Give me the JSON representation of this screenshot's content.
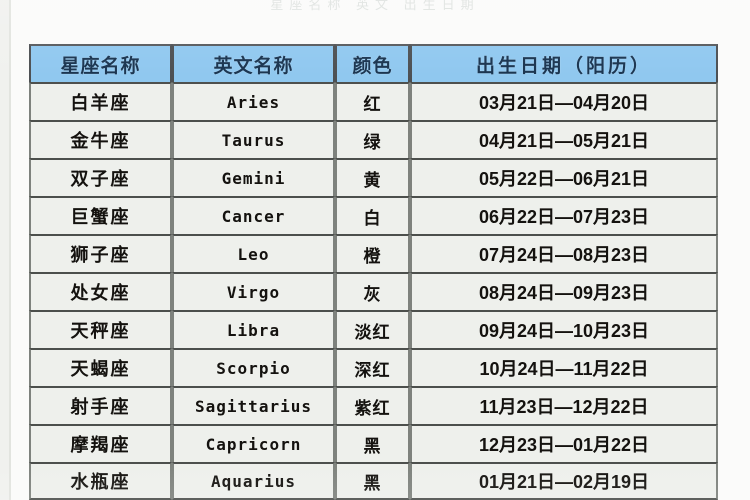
{
  "page": {
    "top_ghost_text": "星座名称   英文   出生日期",
    "background_color": "#fbfbfa"
  },
  "table": {
    "name": "zodiac-signs-table",
    "header_background": "#8ec7ef",
    "row_background": "#eef0ec",
    "border_color": "#4c4f4c",
    "columns": [
      {
        "key": "name",
        "label": "星座名称"
      },
      {
        "key": "en",
        "label": "英文名称"
      },
      {
        "key": "color",
        "label": "颜色"
      },
      {
        "key": "date",
        "label": "出生日期（阳历）"
      }
    ],
    "rows": [
      {
        "name": "白羊座",
        "en": "Aries",
        "color": "红",
        "date": "03月21日—04月20日"
      },
      {
        "name": "金牛座",
        "en": "Taurus",
        "color": "绿",
        "date": "04月21日—05月21日"
      },
      {
        "name": "双子座",
        "en": "Gemini",
        "color": "黄",
        "date": "05月22日—06月21日"
      },
      {
        "name": "巨蟹座",
        "en": "Cancer",
        "color": "白",
        "date": "06月22日—07月23日"
      },
      {
        "name": "狮子座",
        "en": "Leo",
        "color": "橙",
        "date": "07月24日—08月23日"
      },
      {
        "name": "处女座",
        "en": "Virgo",
        "color": "灰",
        "date": "08月24日—09月23日"
      },
      {
        "name": "天秤座",
        "en": "Libra",
        "color": "淡红",
        "date": "09月24日—10月23日"
      },
      {
        "name": "天蝎座",
        "en": "Scorpio",
        "color": "深红",
        "date": "10月24日—11月22日"
      },
      {
        "name": "射手座",
        "en": "Sagittarius",
        "color": "紫红",
        "date": "11月23日—12月22日"
      },
      {
        "name": "摩羯座",
        "en": "Capricorn",
        "color": "黑",
        "date": "12月23日—01月22日"
      },
      {
        "name": "水瓶座",
        "en": "Aquarius",
        "color": "黑",
        "date": "01月21日—02月19日"
      }
    ]
  }
}
